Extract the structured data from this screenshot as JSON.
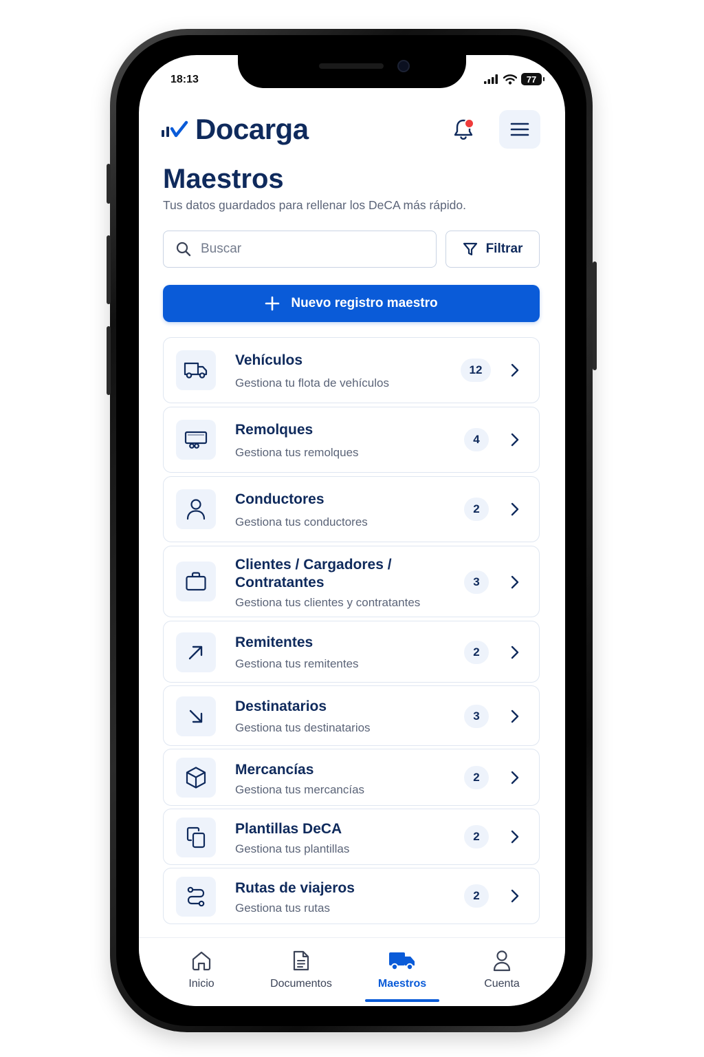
{
  "status_bar": {
    "time": "18:13",
    "battery": "77"
  },
  "header": {
    "app_name": "Docarga",
    "logo_icon": "bar-check-logo",
    "notification_icon": "bell-icon",
    "menu_icon": "hamburger-icon"
  },
  "page": {
    "title": "Maestros",
    "subtitle": "Tus datos guardados para rellenar los DeCA más rápido."
  },
  "search": {
    "placeholder": "Buscar",
    "icon": "search-icon"
  },
  "filter": {
    "label": "Filtrar",
    "icon": "filter-icon"
  },
  "new_button": {
    "label": "Nuevo registro maestro",
    "icon": "plus-icon"
  },
  "items": [
    {
      "title": "Vehículos",
      "subtitle": "Gestiona tu flota de vehículos",
      "count": "12",
      "icon": "truck-icon"
    },
    {
      "title": "Remolques",
      "subtitle": "Gestiona tus remolques",
      "count": "4",
      "icon": "trailer-icon"
    },
    {
      "title": "Conductores",
      "subtitle": "Gestiona tus conductores",
      "count": "2",
      "icon": "user-icon"
    },
    {
      "title": "Clientes / Cargadores / Contratantes",
      "subtitle": "Gestiona tus clientes y contratantes",
      "count": "3",
      "icon": "briefcase-icon"
    },
    {
      "title": "Remitentes",
      "subtitle": "Gestiona tus remitentes",
      "count": "2",
      "icon": "arrow-up-right-icon"
    },
    {
      "title": "Destinatarios",
      "subtitle": "Gestiona tus destinatarios",
      "count": "3",
      "icon": "arrow-down-right-icon"
    },
    {
      "title": "Mercancías",
      "subtitle": "Gestiona tus mercancías",
      "count": "2",
      "icon": "box-icon"
    },
    {
      "title": "Plantillas DeCA",
      "subtitle": "Gestiona tus plantillas",
      "count": "2",
      "icon": "copy-icon"
    },
    {
      "title": "Rutas de viajeros",
      "subtitle": "Gestiona tus rutas",
      "count": "2",
      "icon": "route-icon"
    }
  ],
  "bottom_nav": [
    {
      "label": "Inicio",
      "icon": "home-icon",
      "active": false
    },
    {
      "label": "Documentos",
      "icon": "document-icon",
      "active": false
    },
    {
      "label": "Maestros",
      "icon": "truck-icon",
      "active": true
    },
    {
      "label": "Cuenta",
      "icon": "user-icon",
      "active": false
    }
  ],
  "colors": {
    "primary": "#0a5bd8",
    "navy": "#0f2a5c",
    "muted": "#5b6478",
    "badge_bg": "#eef3fb",
    "notification": "#ef3b3b"
  }
}
